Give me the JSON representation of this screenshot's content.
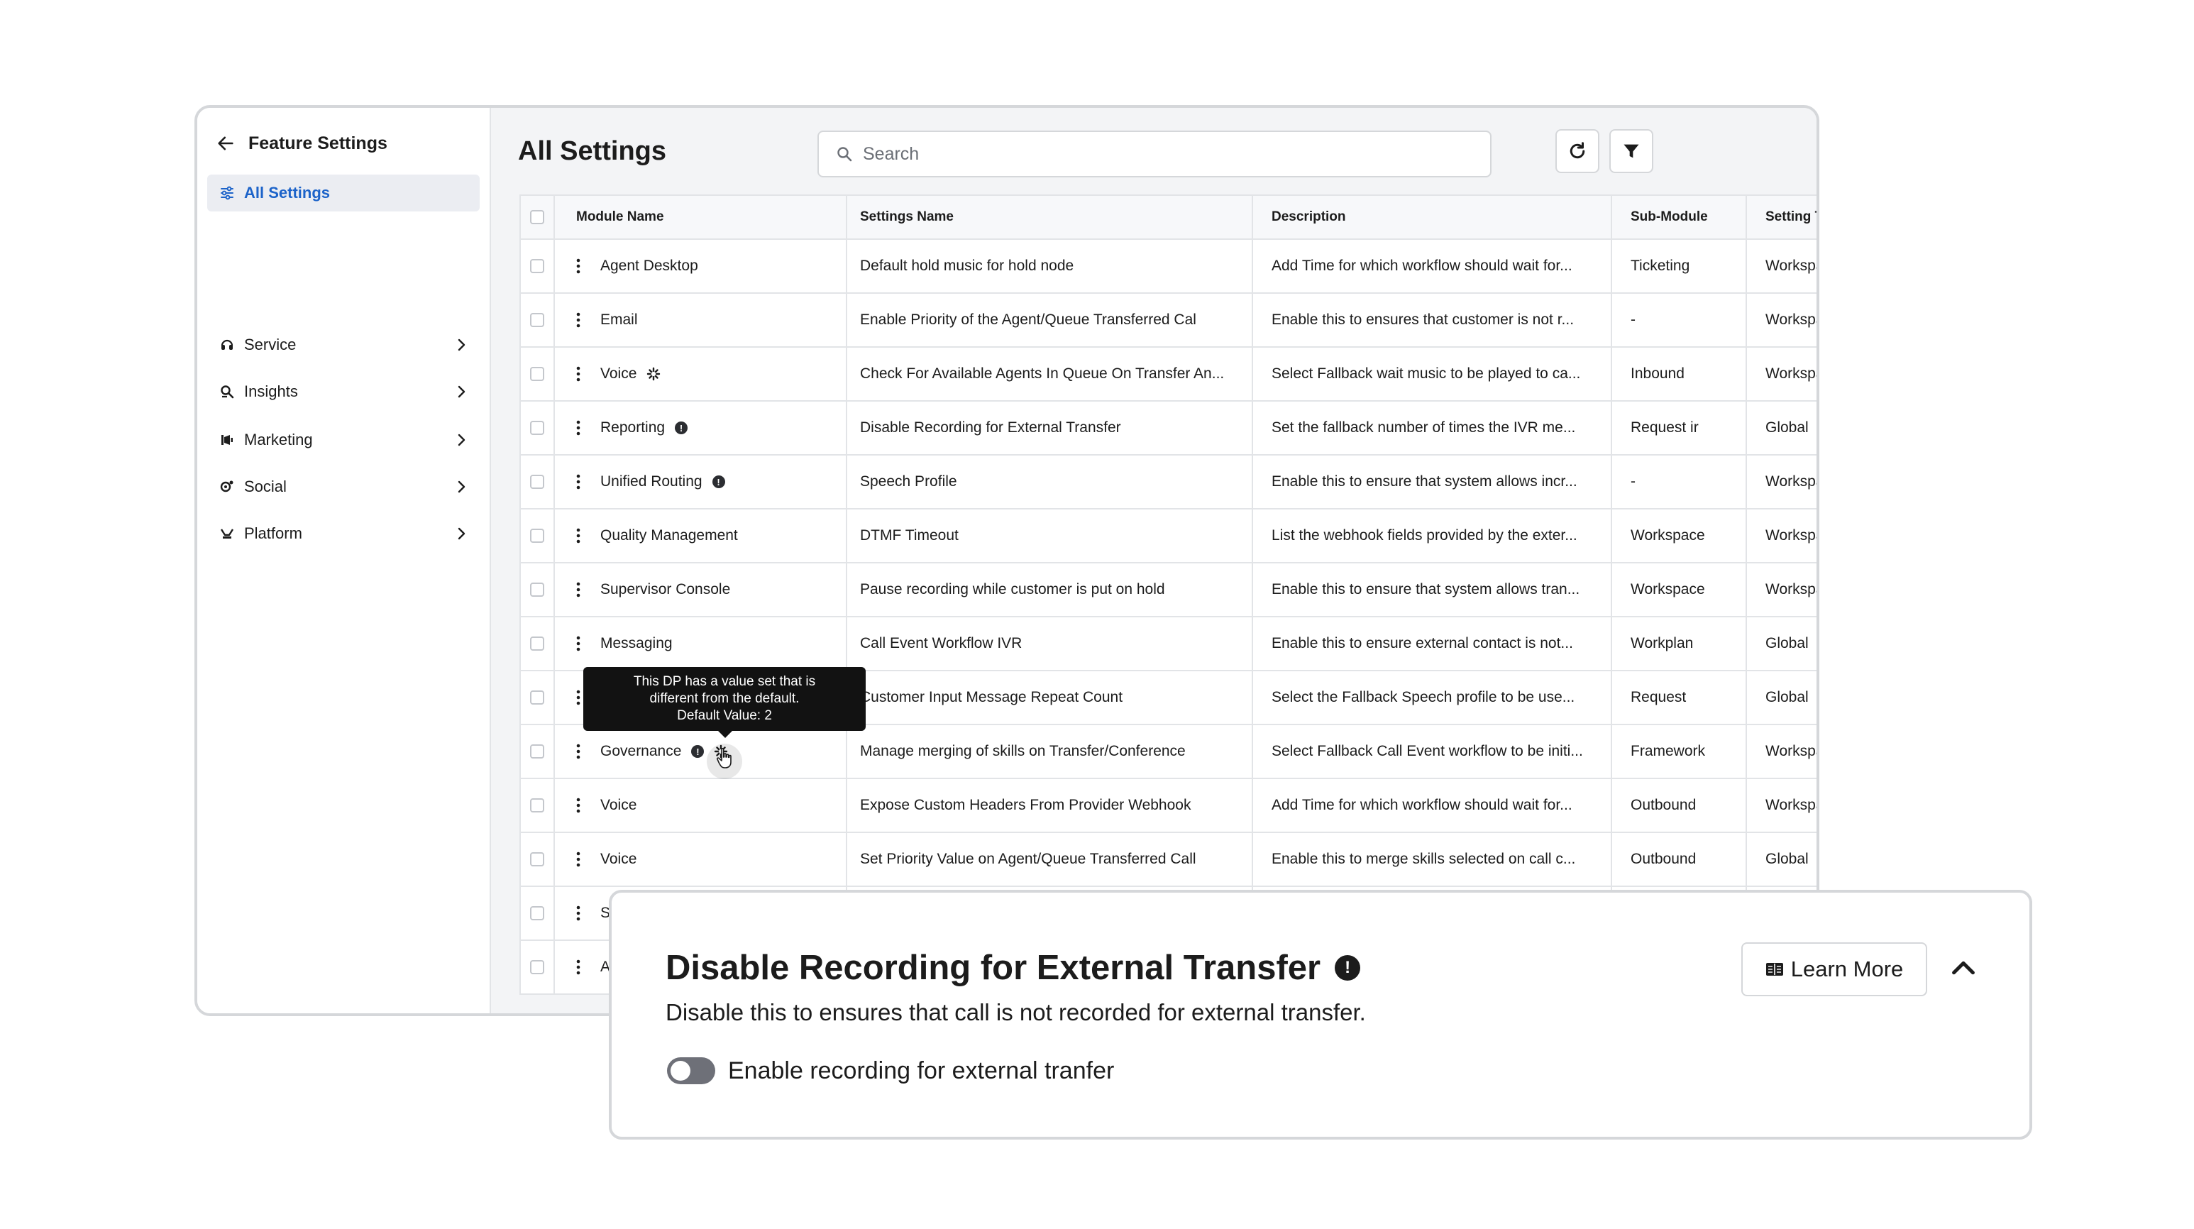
{
  "sidebar": {
    "title": "Feature Settings",
    "active_item": "All Settings",
    "items": [
      {
        "label": "Service",
        "icon": "service-icon"
      },
      {
        "label": "Insights",
        "icon": "insights-icon"
      },
      {
        "label": "Marketing",
        "icon": "marketing-icon"
      },
      {
        "label": "Social",
        "icon": "social-icon"
      },
      {
        "label": "Platform",
        "icon": "platform-icon"
      }
    ]
  },
  "main": {
    "title": "All Settings",
    "search_placeholder": "Search"
  },
  "table": {
    "headers": [
      "Module Name",
      "Settings Name",
      "Description",
      "Sub-Module",
      "Setting Type"
    ],
    "rows": [
      {
        "module": "Agent Desktop",
        "setting": "Default hold music for hold node",
        "description": "Add Time for which workflow should wait for...",
        "sub": "Ticketing",
        "stype": "Workspace"
      },
      {
        "module": "Email",
        "setting": "Enable Priority of the Agent/Queue Transferred Cal",
        "description": "Enable this to ensures that customer is not r...",
        "sub": "-",
        "stype": "Workspace"
      },
      {
        "module": "Voice",
        "setting": "Check For Available Agents In Queue On Transfer An...",
        "description": "Select Fallback wait music to be played to ca...",
        "sub": "Inbound",
        "stype": "Workspace"
      },
      {
        "module": "Reporting",
        "setting": "Disable Recording for External Transfer",
        "description": "Set the fallback number of times the IVR me...",
        "sub": "Request ir",
        "stype": "Global"
      },
      {
        "module": "Unified Routing",
        "setting": "Speech Profile",
        "description": "Enable this to ensure that system allows incr...",
        "sub": "-",
        "stype": "Workspace"
      },
      {
        "module": "Quality Management",
        "setting": "DTMF Timeout",
        "description": "List the webhook fields provided by the exter...",
        "sub": "Workspace",
        "stype": "Workspace"
      },
      {
        "module": "Supervisor Console",
        "setting": "Pause recording while customer is put on hold",
        "description": "Enable this to ensure that system allows tran...",
        "sub": "Workspace",
        "stype": "Workspace"
      },
      {
        "module": "Messaging",
        "setting": "Call Event Workflow IVR",
        "description": "Enable this to ensure external contact is not...",
        "sub": "Workplan",
        "stype": "Global"
      },
      {
        "module": "",
        "setting": "Customer Input Message Repeat Count",
        "description": "Select the Fallback Speech profile to be use...",
        "sub": "Request",
        "stype": "Global"
      },
      {
        "module": "Governance",
        "setting": "Manage merging of skills on Transfer/Conference",
        "description": "Select Fallback Call Event workflow to be initi...",
        "sub": "Framework",
        "stype": "Workspace"
      },
      {
        "module": "Voice",
        "setting": "Expose Custom Headers From Provider Webhook",
        "description": "Add Time for which workflow should wait for...",
        "sub": "Outbound",
        "stype": "Workspace"
      },
      {
        "module": "Voice",
        "setting": "Set Priority Value on Agent/Queue Transferred Call",
        "description": "Enable this to merge skills selected on call c...",
        "sub": "Outbound",
        "stype": "Global"
      },
      {
        "module": "S",
        "setting": "",
        "description": "",
        "sub": "",
        "stype": ""
      },
      {
        "module": "A",
        "setting": "",
        "description": "",
        "sub": "",
        "stype": ""
      }
    ]
  },
  "tooltip": {
    "line1": "This DP has a value set that is",
    "line2": "different from the default.",
    "line3": "Default Value: 2"
  },
  "detail": {
    "title": "Disable Recording for External Transfer",
    "description": "Disable this to ensures that call is not recorded for external transfer.",
    "toggle_label": "Enable recording for external tranfer",
    "toggle_on": false,
    "learn_more": "Learn More"
  },
  "colors": {
    "accent": "#1c63c9",
    "toggle_off": "#6e7078"
  }
}
